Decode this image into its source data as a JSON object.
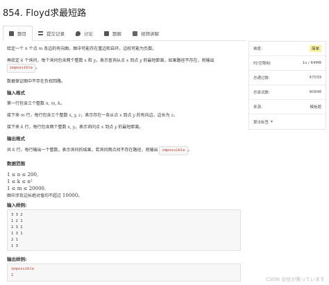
{
  "problem": {
    "title": "854. Floyd求最短路"
  },
  "tabs": [
    {
      "label": "题目",
      "icon": "document-icon"
    },
    {
      "label": "提交记录",
      "icon": "list-icon"
    },
    {
      "label": "讨论",
      "icon": "chat-icon"
    },
    {
      "label": "题解",
      "icon": "book-icon"
    },
    {
      "label": "视频讲解",
      "icon": "video-icon"
    }
  ],
  "statement": {
    "p1_a": "给定一个 ",
    "p1_n": "n",
    "p1_b": " 个点 ",
    "p1_m": "m",
    "p1_c": " 条边的有向图，图中可能存在重边和自环，边权可能为负数。",
    "p2_a": "再给定 ",
    "p2_k": "k",
    "p2_b": " 个询问，每个询问包含两个整数 ",
    "p2_x": "x",
    "p2_c": " 和 ",
    "p2_y": "y",
    "p2_d": "，表示查询从点 ",
    "p2_x2": "x",
    "p2_e": " 到点 ",
    "p2_y2": "y",
    "p2_f": " 的最短距离，如果路径不存在，则输出",
    "impossible": "impossible",
    "p2_g": "。",
    "p3": "数据保证图中不存在负权回路。"
  },
  "input_format": {
    "heading": "输入格式",
    "l1_a": "第一行包含三个整数 ",
    "l1_v": "n, m, k",
    "l1_b": "。",
    "l2_a": "接下来 ",
    "l2_m": "m",
    "l2_b": " 行，每行包含三个整数 ",
    "l2_v": "x, y, z",
    "l2_c": "，表示存在一条从点 ",
    "l2_x": "x",
    "l2_d": " 到点 ",
    "l2_y": "y",
    "l2_e": " 的有向边，边长为 ",
    "l2_z": "z",
    "l2_f": "。",
    "l3_a": "接下来 ",
    "l3_k": "k",
    "l3_b": " 行，每行包含两个整数 ",
    "l3_v": "x, y",
    "l3_c": "，表示询问点 ",
    "l3_x": "x",
    "l3_d": " 到点 ",
    "l3_y": "y",
    "l3_e": " 的最短距离。"
  },
  "output_format": {
    "heading": "输出格式",
    "l1_a": "共 ",
    "l1_k": "k",
    "l1_b": " 行，每行输出一个整数，表示询问的结果，若询问两点间不存在路径，则输出 ",
    "impossible": "impossible",
    "l1_c": "。"
  },
  "data_range": {
    "heading": "数据范围",
    "r1": "1 ≤ n ≤ 200,",
    "r2": "1 ≤ k ≤ n²",
    "r3": "1 ≤ m ≤ 20000.",
    "r4_a": "图中涉及边长绝对值均不超过 ",
    "r4_v": "10000",
    "r4_b": "。"
  },
  "sample_input": {
    "heading": "输入样例:",
    "lines": [
      "3 3 2",
      "1 2 1",
      "2 3 2",
      "1 3 1",
      "2 1",
      "1 3"
    ]
  },
  "sample_output": {
    "heading": "输出样例:",
    "lines": [
      "impossible",
      "1"
    ]
  },
  "sidebar": [
    {
      "label": "难度:",
      "value": "简单"
    },
    {
      "label": "时/空限制:",
      "value": "1s / 64MB"
    },
    {
      "label": "总通过数:",
      "value": "47039"
    },
    {
      "label": "总尝试数:",
      "value": "90848"
    },
    {
      "label": "来源:",
      "value": "模板题"
    },
    {
      "label": "算法标签",
      "value": ""
    }
  ],
  "footer": {
    "watermark": "CSDN @空が笑っています"
  },
  "colors": {
    "difficulty_bg": "#fdf2a4",
    "code_red": "#c0392b"
  }
}
